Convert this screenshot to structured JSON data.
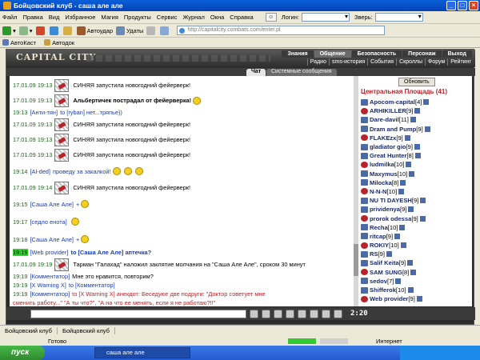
{
  "window": {
    "title": "Бойцовский клуб - саша але але"
  },
  "menu": {
    "items": [
      "Файл",
      "Правка",
      "Вид",
      "Избранное",
      "Магия",
      "Продукты",
      "Сервис",
      "Журнал",
      "Окна",
      "Справка"
    ],
    "login_label": "Логин:",
    "animal_label": "Зверь:"
  },
  "toolbar": {
    "autoudar": "Автоудар",
    "udaty": "Удаты",
    "address": "http://capitalcity.combats.com/enter.pl"
  },
  "links": {
    "autokast": "АвтоКаст",
    "autodok": "Автодок"
  },
  "game": {
    "logo": "CAPITAL CITY",
    "nav_top": [
      "Знания",
      "Общение",
      "Безопасность",
      "Персонаж",
      "Выход"
    ],
    "nav_bottom": [
      "Радио",
      "sms-история",
      "События",
      "Скроллы",
      "Форум",
      "Рейтинг"
    ],
    "tab_chat": "Чат",
    "tab_sys": "Системные сообщения"
  },
  "chat": [
    {
      "ts": "17.01.09 19:13",
      "icon": true,
      "text": "СИНЯЯ запустила новогодний фейерверк!"
    },
    {
      "ts": "17.01.09 19:13",
      "icon": true,
      "text": "Альбертичек пострадал от фейерверка!",
      "bold": true
    },
    {
      "ts": "19:13",
      "user": "[Анти-тян]",
      "to": "to [ryban] нет...тряпье))"
    },
    {
      "ts": "17.01.09 19:13",
      "icon": true,
      "text": "СИНЯЯ запустила новогодний фейерверк!"
    },
    {
      "ts": "17.01.09 19:13",
      "icon": true,
      "text": "СИНЯЯ запустила новогодний фейерверк!"
    },
    {
      "ts": "17.01.09 19:13",
      "icon": true,
      "text": "СИНЯЯ запустила новогодний фейерверк!"
    },
    {
      "ts": "19:14",
      "user": "[Al-ded]",
      "to": "проведу за закалкой!"
    },
    {
      "ts": "17.01.09 19:14",
      "icon": true,
      "text": "СИНЯЯ запустила новогодний фейерверк!"
    },
    {
      "ts": "19:15",
      "user": "[Саша Але Але]",
      "to": "+"
    },
    {
      "ts": "19:17",
      "user": "[седло енота]",
      "to": ""
    },
    {
      "ts": "19:18",
      "user": "[Саша Але Але]",
      "to": "+"
    },
    {
      "ts": "19:19",
      "user": "[Web provider]",
      "to": "to [Саша Але Але] аптечка?",
      "hl": true
    },
    {
      "ts": "17.01.09 19:19",
      "icon": true,
      "text": "Тарман \"Галахад\" наложил заклятие молчания на \"Саша Але Але\", сроком 30 минут"
    },
    {
      "ts": "19:19",
      "user": "[Комментатор]",
      "to": "Мне это нравится, повторим?"
    },
    {
      "ts": "19:19",
      "user": "[X Warning X]",
      "to": "to [Комментатор]"
    },
    {
      "ts": "19:19",
      "user": "[Комментатор]",
      "to": "to [X Warning X] анекдот: Беседуют две подруги: \"Доктор советует мне"
    },
    {
      "ts": "",
      "user": "",
      "to": "сменить работу...\" \"А ты что?\", \"А на что ее менять, если я не работаю?!!\""
    }
  ],
  "right": {
    "refresh": "Обновить",
    "location": "Центральная Площадь (41)",
    "users": [
      {
        "name": "Apocom-capital",
        "lvl": "[4]"
      },
      {
        "name": "ARHIKILLER",
        "lvl": "[9]"
      },
      {
        "name": "Dare-davil",
        "lvl": "[11]"
      },
      {
        "name": "Dram and Pump",
        "lvl": "[9]"
      },
      {
        "name": "FLAKEzx",
        "lvl": "[9]"
      },
      {
        "name": "gladiator gio",
        "lvl": "[9]"
      },
      {
        "name": "Great Hunter",
        "lvl": "[8]"
      },
      {
        "name": "ludmilka",
        "lvl": "[10]"
      },
      {
        "name": "Maxymus",
        "lvl": "[10]"
      },
      {
        "name": "Milocka",
        "lvl": "[8]"
      },
      {
        "name": "N-N-N",
        "lvl": "[10]"
      },
      {
        "name": "NU TI DAYESH",
        "lvl": "[9]"
      },
      {
        "name": "prividenya",
        "lvl": "[9]"
      },
      {
        "name": "prorok odessa",
        "lvl": "[9]"
      },
      {
        "name": "Recha",
        "lvl": "[10]"
      },
      {
        "name": "ritcap",
        "lvl": "[9]"
      },
      {
        "name": "ROKIY",
        "lvl": "[10]"
      },
      {
        "name": "RS",
        "lvl": "[9]"
      },
      {
        "name": "Salif Keita",
        "lvl": "[9]"
      },
      {
        "name": "SAM SUNG",
        "lvl": "[8]"
      },
      {
        "name": "sedov",
        "lvl": "[7]"
      },
      {
        "name": "Shifferok",
        "lvl": "[10]"
      },
      {
        "name": "Web provider",
        "lvl": "[9]"
      }
    ]
  },
  "gamebar": {
    "time": "2:20"
  },
  "statusbar": {
    "tab1": "Бойцовский клуб",
    "tab2": "Бойцовский клуб"
  },
  "ie": {
    "done": "Готово",
    "zone": "Интернет"
  },
  "taskbar": {
    "start": "пуск",
    "task": "саша але але"
  }
}
